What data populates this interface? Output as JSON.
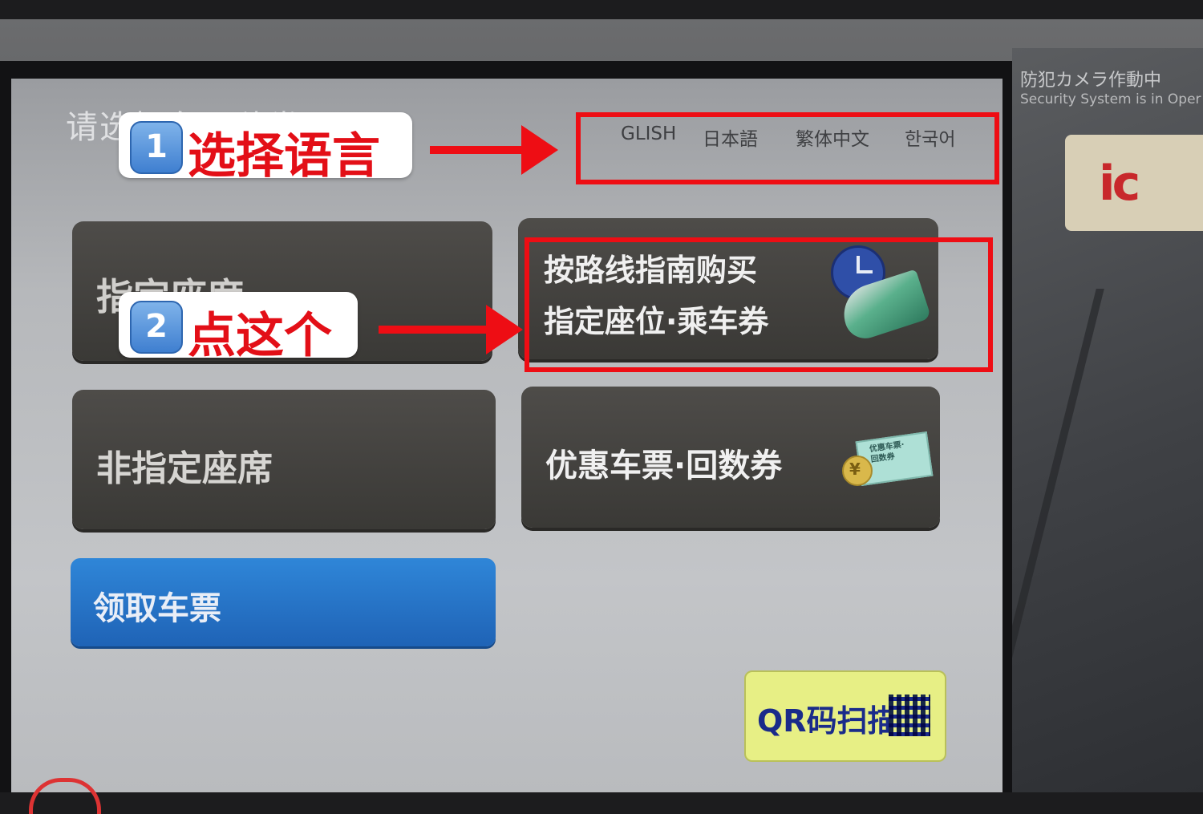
{
  "camera_notice": {
    "ja": "防犯カメラ作動中",
    "en": "Security System is in Oper"
  },
  "ic_reader": {
    "logo": "ic"
  },
  "screen": {
    "prompt": "请选择车票种类",
    "languages": [
      "GLISH",
      "日本語",
      "繁体中文",
      "한국어"
    ],
    "buttons": {
      "reserved_seat": "指定座席",
      "route_guide_line1": "按路线指南购买",
      "route_guide_line2": "指定座位·乘车券",
      "non_reserved": "非指定座席",
      "discount": "优惠车票·回数券",
      "discount_icon_text": "优惠车票·\n回数券",
      "pickup": "领取车票",
      "qr": "QR码扫描"
    }
  },
  "annotations": {
    "step1": {
      "number": "1",
      "text": "选择语言"
    },
    "step2": {
      "number": "2",
      "text": "点这个"
    },
    "highlight_color": "#ee0d14"
  }
}
